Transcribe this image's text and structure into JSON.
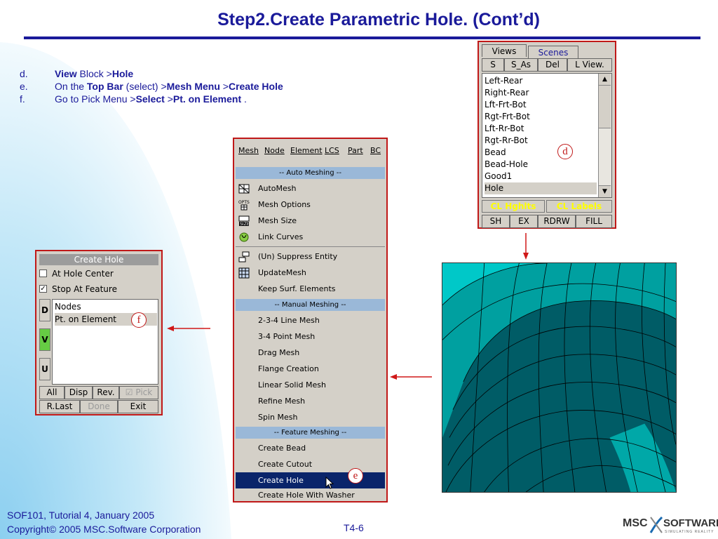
{
  "title": "Step2.Create Parametric Hole. (Cont’d)",
  "steps": [
    {
      "letter": "d.",
      "parts": [
        {
          "t": "View",
          "b": true
        },
        {
          "t": " Block  >",
          "b": false
        },
        {
          "t": "Hole",
          "b": true
        }
      ]
    },
    {
      "letter": "e.",
      "parts": [
        {
          "t": "On the ",
          "b": false
        },
        {
          "t": "Top Bar",
          "b": true
        },
        {
          "t": " (select) >",
          "b": false
        },
        {
          "t": "Mesh Menu",
          "b": true
        },
        {
          "t": " >",
          "b": false
        },
        {
          "t": "Create Hole",
          "b": true
        }
      ]
    },
    {
      "letter": "f.",
      "parts": [
        {
          "t": "Go to Pick Menu >",
          "b": false
        },
        {
          "t": "Select",
          "b": true
        },
        {
          "t": " >",
          "b": false
        },
        {
          "t": "Pt. on Element",
          "b": true
        },
        {
          "t": " .",
          "b": false
        }
      ]
    }
  ],
  "create_hole": {
    "title": "Create Hole",
    "checkboxes": [
      {
        "label": "At Hole Center",
        "checked": false
      },
      {
        "label": "Stop At Feature",
        "checked": true
      }
    ],
    "side_buttons": [
      "D",
      "V",
      "U"
    ],
    "list_items": [
      "Nodes",
      "Pt. on Element"
    ],
    "row1": [
      "All",
      "Disp",
      "Rev."
    ],
    "pick_label": "Pick",
    "row2": [
      "R.Last",
      "Done",
      "Exit"
    ]
  },
  "mesh_menu": {
    "menubar": [
      "Mesh",
      "Node",
      "Element",
      "LCS",
      "Part",
      "BC"
    ],
    "sections": {
      "auto": "-- Auto Meshing --",
      "manual": "-- Manual Meshing --",
      "feature": "-- Feature Meshing --"
    },
    "auto_items": [
      "AutoMesh",
      "Mesh Options",
      "Mesh Size",
      "Link Curves"
    ],
    "misc_items": [
      "(Un) Suppress Entity",
      "UpdateMesh",
      "Keep Surf. Elements"
    ],
    "manual_items": [
      "2-3-4 Line Mesh",
      "3-4 Point Mesh",
      "Drag Mesh",
      "Flange Creation",
      "Linear Solid Mesh",
      "Refine Mesh",
      "Spin Mesh"
    ],
    "feature_items": [
      "Create Bead",
      "Create Cutout",
      "Create Hole",
      "Create Hole With Washer"
    ],
    "selected": "Create Hole"
  },
  "views_panel": {
    "tabs": [
      "Views",
      "Scenes"
    ],
    "buttons": [
      "S",
      "S_As",
      "Del",
      "L View."
    ],
    "list": [
      "Left-Rear",
      "Right-Rear",
      "Lft-Frt-Bot",
      "Rgt-Frt-Bot",
      "Lft-Rr-Bot",
      "Rgt-Rr-Bot",
      "Bead",
      "Bead-Hole",
      "Good1",
      "Hole"
    ],
    "selected": "Hole",
    "highlight_buttons": [
      "CL Hghlts",
      "CL Labels"
    ],
    "bottom_buttons": [
      "SH",
      "EX",
      "RDRW",
      "FILL"
    ]
  },
  "callouts": {
    "d": "d",
    "e": "e",
    "f": "f"
  },
  "footer": {
    "line1": "SOF101, Tutorial 4, January 2005",
    "line2": "Copyright© 2005 MSC.Software Corporation",
    "page": "T4-6"
  },
  "logo": {
    "left": "MSC",
    "right": "SOFTWARE",
    "tagline": "SIMULATING REALITY"
  },
  "colors": {
    "title": "#1a1a9a",
    "accent": "#c01818",
    "arc_light": "#a8dcf4",
    "mesh_dark": "#005c66",
    "mesh_light": "#00d0d0"
  }
}
